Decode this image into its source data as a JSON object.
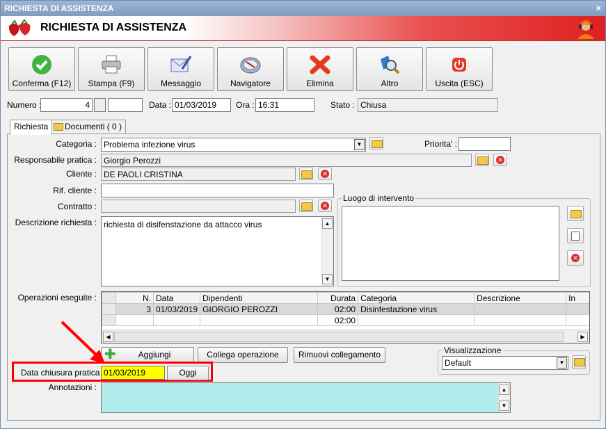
{
  "window": {
    "title": "RICHIESTA DI ASSISTENZA",
    "close": "×"
  },
  "header": {
    "title": "RICHIESTA DI ASSISTENZA"
  },
  "toolbar": [
    {
      "label": "Conferma (F12)",
      "icon": "check-icon"
    },
    {
      "label": "Stampa (F9)",
      "icon": "printer-icon"
    },
    {
      "label": "Messaggio",
      "icon": "envelope-icon"
    },
    {
      "label": "Navigatore",
      "icon": "compass-icon"
    },
    {
      "label": "Elimina",
      "icon": "x-icon"
    },
    {
      "label": "Altro",
      "icon": "search-icon"
    },
    {
      "label": "Uscita (ESC)",
      "icon": "power-icon"
    }
  ],
  "info": {
    "numero_label": "Numero :",
    "numero": "4",
    "data_label": "Data :",
    "data": "01/03/2019",
    "ora_label": "Ora :",
    "ora": "16:31",
    "stato_label": "Stato :",
    "stato": "Chiusa"
  },
  "tabs": [
    {
      "label": "Richiesta"
    },
    {
      "label": "Documenti ( 0 )"
    }
  ],
  "form": {
    "categoria_label": "Categoria :",
    "categoria": "Problema infezione virus",
    "priorita_label": "Priorita' :",
    "priorita": "",
    "responsabile_label": "Responsabile pratica :",
    "responsabile": "Giorgio Perozzi",
    "cliente_label": "Cliente :",
    "cliente": "DE PAOLI CRISTINA",
    "rif_label": "Rif. cliente :",
    "rif": "",
    "contratto_label": "Contratto :",
    "contratto": "",
    "descrizione_label": "Descrizione richiesta :",
    "descrizione": "richiesta di disifenstazione da attacco virus",
    "luogo_label": "Luogo di intervento",
    "operazioni_label": "Operazioni eseguite :",
    "data_chiusura_label": "Data chiusura pratica :",
    "data_chiusura": "01/03/2019",
    "oggi": "Oggi",
    "annotazioni_label": "Annotazioni :"
  },
  "grid": {
    "columns": [
      "N.",
      "Data",
      "Dipendenti",
      "Durata",
      "Categoria",
      "Descrizione",
      "In"
    ],
    "rows": [
      [
        "3",
        "01/03/2019",
        "GIORGIO PEROZZI",
        "02:00",
        "Disinfestazione virus",
        "",
        ""
      ],
      [
        "",
        "",
        "",
        "02:00",
        "",
        "",
        ""
      ]
    ]
  },
  "actions": {
    "aggiungi": "Aggiungi",
    "collega": "Collega operazione",
    "rimuovi": "Rimuovi collegamento"
  },
  "visualizzazione": {
    "label": "Visualizzazione",
    "value": "Default"
  },
  "colors": {
    "highlight": "#ff0000",
    "date_bg": "#ffff00",
    "annot_bg": "#b0ecec"
  }
}
